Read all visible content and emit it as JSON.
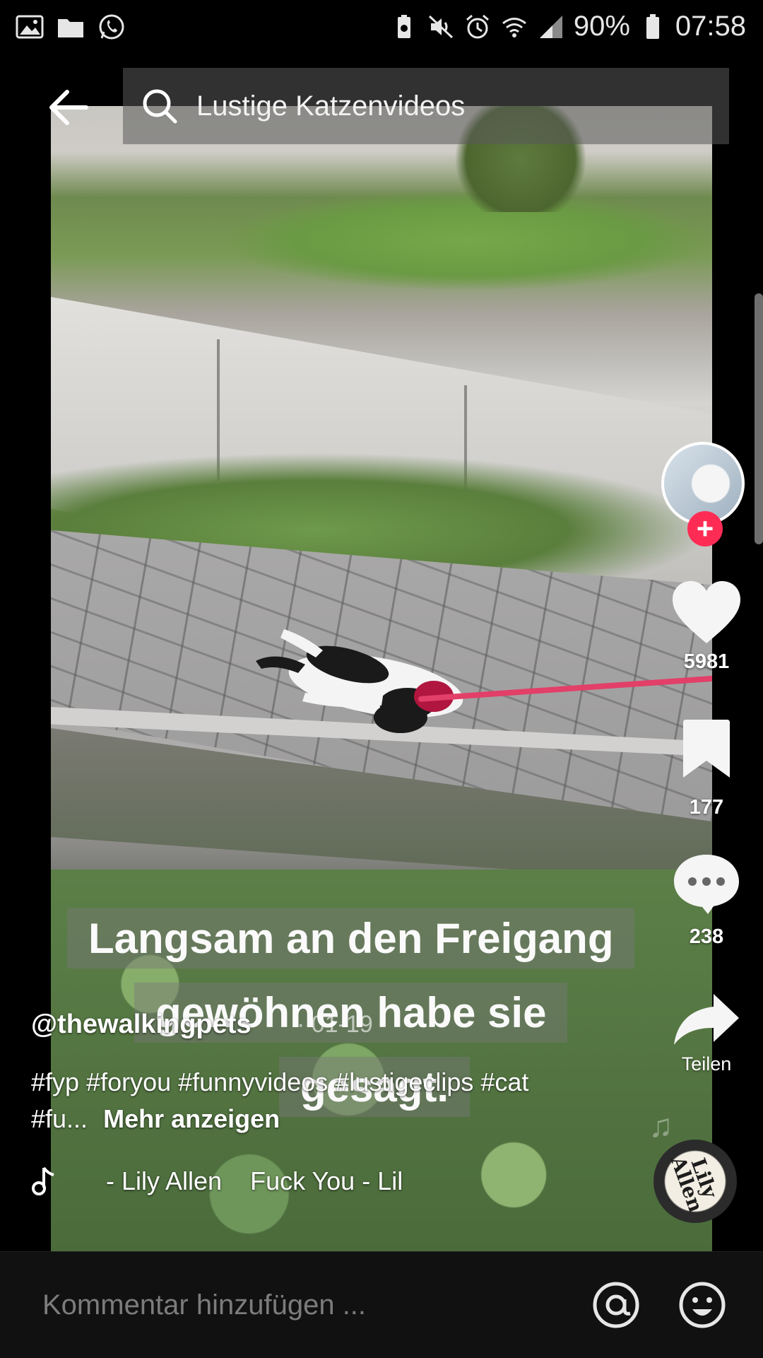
{
  "status_bar": {
    "battery_percent": "90%",
    "time": "07:58",
    "left_icons": [
      "gallery-icon",
      "folder-icon",
      "whatsapp-icon"
    ],
    "right_icons": [
      "battery-saver-icon",
      "mute-icon",
      "alarm-icon",
      "wifi-icon",
      "signal-icon",
      "battery-icon"
    ]
  },
  "search": {
    "query": "Lustige Katzenvideos"
  },
  "video": {
    "caption_lines": [
      "Langsam an den Freigang",
      "gewöhnen habe sie",
      "gesagt."
    ]
  },
  "rail": {
    "likes": "5981",
    "saves": "177",
    "comments": "238",
    "share_label": "Teilen"
  },
  "post": {
    "username": "@thewalkingpets",
    "time_ago": "· 01-19",
    "description": "#fyp #foryou #funnyvideos #lustigeclips #cat #fu...",
    "more_label": "Mehr anzeigen",
    "music_title": "- Lily Allen    Fuck You - Lil",
    "disc_text": "Lily Allen"
  },
  "comment_bar": {
    "placeholder": "Kommentar hinzufügen ..."
  },
  "colors": {
    "accent": "#fe2c55",
    "background": "#000000",
    "comment_bar": "#111111"
  }
}
